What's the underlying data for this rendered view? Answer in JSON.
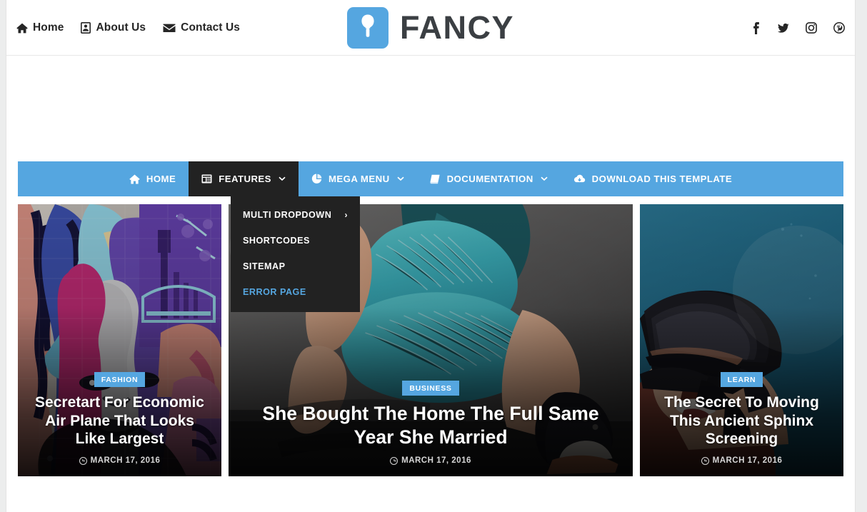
{
  "header": {
    "topnav": [
      {
        "label": "Home",
        "icon": "home-icon"
      },
      {
        "label": "About Us",
        "icon": "id-card-icon"
      },
      {
        "label": "Contact Us",
        "icon": "envelope-icon"
      }
    ],
    "logo": {
      "text": "FANCY",
      "mark_icon": "popsicle-icon",
      "mark_color": "#55a6e0",
      "text_color": "#3b3f43"
    },
    "social": [
      {
        "name": "facebook-icon",
        "label": "Facebook"
      },
      {
        "name": "twitter-icon",
        "label": "Twitter"
      },
      {
        "name": "instagram-icon",
        "label": "Instagram"
      },
      {
        "name": "pinterest-icon",
        "label": "Pinterest"
      }
    ]
  },
  "mainnav": {
    "background": "#55a6e0",
    "active_background": "#222222",
    "items": [
      {
        "label": "HOME",
        "icon": "home-icon",
        "caret": "",
        "active": false
      },
      {
        "label": "FEATURES",
        "icon": "window-icon",
        "caret": "⌄",
        "active": true
      },
      {
        "label": "MEGA MENU",
        "icon": "pie-chart-icon",
        "caret": "⌄",
        "active": false
      },
      {
        "label": "DOCUMENTATION",
        "icon": "book-icon",
        "caret": "⌄",
        "active": false
      },
      {
        "label": "DOWNLOAD THIS TEMPLATE",
        "icon": "cloud-download-icon",
        "caret": "",
        "active": false
      }
    ]
  },
  "dropdown": {
    "open_for": "FEATURES",
    "background": "#222222",
    "highlight_color": "#55a6e0",
    "items": [
      {
        "label": "MULTI DROPDOWN",
        "arrow": "›",
        "highlight": false
      },
      {
        "label": "SHORTCODES",
        "arrow": "",
        "highlight": false
      },
      {
        "label": "SITEMAP",
        "arrow": "",
        "highlight": false
      },
      {
        "label": "ERROR PAGE",
        "arrow": "",
        "highlight": true
      }
    ]
  },
  "cards": [
    {
      "size": "small",
      "badge": "FASHION",
      "title": "Secretart For Economic Air Plane That Looks Like Largest",
      "date": "MARCH 17, 2016",
      "date_icon": "clock-icon",
      "art": "graffiti-mural"
    },
    {
      "size": "large",
      "badge": "BUSINESS",
      "title": "She Bought The Home The Full Same Year She Married",
      "date": "MARCH 17, 2016",
      "date_icon": "clock-icon",
      "art": "fitness-photo"
    },
    {
      "size": "small",
      "badge": "LEARN",
      "title": "The Secret To Moving This Ancient Sphinx Screening",
      "date": "MARCH 17, 2016",
      "date_icon": "clock-icon",
      "art": "vr-headset-photo"
    }
  ]
}
